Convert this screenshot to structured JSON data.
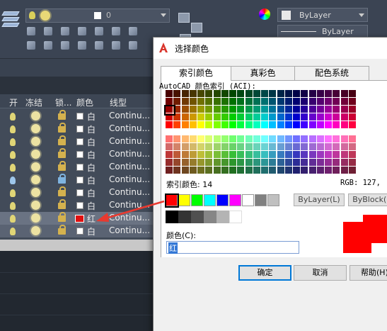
{
  "ribbon": {
    "layer_combo_value": "0",
    "color_combo_value": "ByLayer",
    "linetype_combo_value": "ByLayer"
  },
  "layer_table": {
    "headers": {
      "on": "开",
      "freeze": "冻结",
      "lock": "锁...",
      "color": "颜色",
      "linetype": "线型"
    },
    "rows": [
      {
        "color_name": "白",
        "linetype": "Continu..."
      },
      {
        "color_name": "白",
        "linetype": "Continu..."
      },
      {
        "color_name": "白",
        "linetype": "Continu..."
      },
      {
        "color_name": "白",
        "linetype": "Continu..."
      },
      {
        "color_name": "白",
        "linetype": "Continu..."
      },
      {
        "color_name": "白",
        "linetype": "Continu..."
      },
      {
        "color_name": "白",
        "linetype": "Continu..."
      },
      {
        "color_name": "白",
        "linetype": "Continu..."
      },
      {
        "color_name": "红",
        "linetype": "Continu..."
      },
      {
        "color_name": "白",
        "linetype": "Continu..."
      }
    ]
  },
  "dialog": {
    "title": "选择颜色",
    "tabs": [
      "索引颜色",
      "真彩色",
      "配色系统"
    ],
    "aci_label": "AutoCAD 颜色索引 (ACI):",
    "index_label": "索引颜色: 14",
    "rgb_label": "RGB:    127,",
    "bylayer_button": "ByLayer(L)",
    "byblock_button": "ByBlock(K)",
    "color_label": "颜色(C):",
    "color_value": "红",
    "ok_button": "确定",
    "cancel_button": "取消",
    "help_button": "帮助(H)",
    "selected_color": "#ff0000"
  }
}
